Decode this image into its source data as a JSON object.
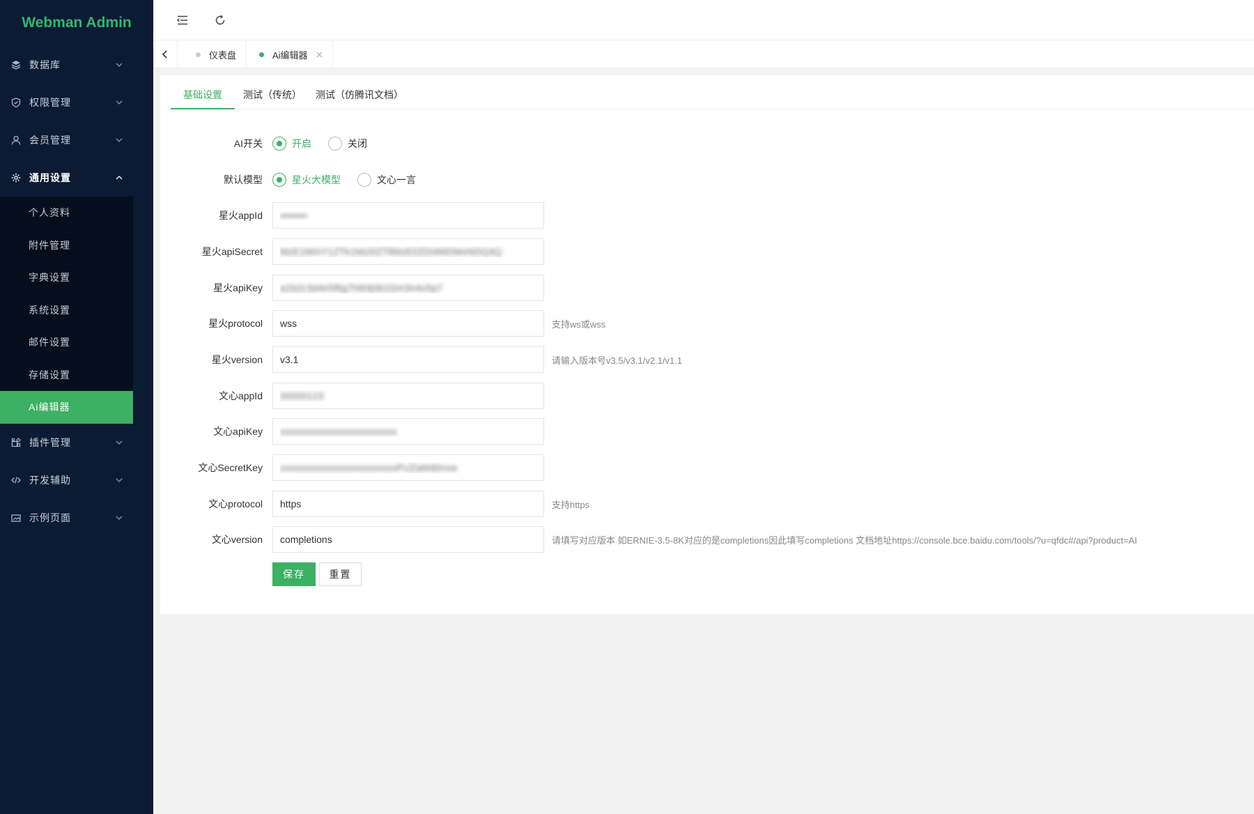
{
  "app": {
    "title": "Webman Admin"
  },
  "sidebar": {
    "items": [
      {
        "label": "数据库",
        "icon": "database-icon"
      },
      {
        "label": "权限管理",
        "icon": "shield-icon"
      },
      {
        "label": "会员管理",
        "icon": "user-icon"
      },
      {
        "label": "通用设置",
        "icon": "gear-icon",
        "open": true,
        "children": [
          "个人资料",
          "附件管理",
          "字典设置",
          "系统设置",
          "邮件设置",
          "存储设置",
          "Ai编辑器"
        ]
      },
      {
        "label": "插件管理",
        "icon": "plugin-icon"
      },
      {
        "label": "开发辅助",
        "icon": "code-icon"
      },
      {
        "label": "示例页面",
        "icon": "image-icon"
      }
    ],
    "active_child": "Ai编辑器"
  },
  "page_tabs": [
    {
      "label": "仪表盘",
      "active": false
    },
    {
      "label": "Ai编辑器",
      "active": true
    }
  ],
  "form_tabs": [
    "基础设置",
    "测试（传统）",
    "测试（仿腾讯文档）"
  ],
  "form": {
    "ai_switch": {
      "label": "AI开关",
      "options": [
        "开启",
        "关闭"
      ],
      "selected": "开启"
    },
    "default_model": {
      "label": "默认模型",
      "options": [
        "星火大模型",
        "文心一言"
      ],
      "selected": "星火大模型"
    },
    "fields": [
      {
        "label": "星火appId",
        "value": "••••••••",
        "blurred": true,
        "hint": ""
      },
      {
        "label": "星火apiSecret",
        "value": "MzE1MmY1ZTk1MzI0ZTllMzE0ZDI4MDMxNDQ4Q",
        "blurred": true,
        "hint": ""
      },
      {
        "label": "星火apiKey",
        "value": "a1b2c3d4e5f6g7h8i9j0k1l2m3n4o5p7",
        "blurred": true,
        "hint": ""
      },
      {
        "label": "星火protocol",
        "value": "wss",
        "blurred": false,
        "hint": "支持ws或wss"
      },
      {
        "label": "星火version",
        "value": "v3.1",
        "blurred": false,
        "hint": "请输入版本号v3.5/v3.1/v2.1/v1.1"
      },
      {
        "label": "文心appId",
        "value": "00000123",
        "blurred": true,
        "hint": ""
      },
      {
        "label": "文心apiKey",
        "value": "xxxxxxxxxxxxxxxxxxxxxxxx",
        "blurred": true,
        "hint": ""
      },
      {
        "label": "文心SecretKey",
        "value": "xxxxxxxxxxxxxxxxxxxxxxxxFUZaM4lmvw",
        "blurred": true,
        "hint": ""
      },
      {
        "label": "文心protocol",
        "value": "https",
        "blurred": false,
        "hint": "支持https"
      },
      {
        "label": "文心version",
        "value": "completions",
        "blurred": false,
        "hint": "请填写对应版本 如ERNIE-3.5-8K对应的是completions因此填写completions 文档地址https://console.bce.baidu.com/tools/?u=qfdc#/api?product=AI"
      }
    ],
    "buttons": {
      "save": "保存",
      "reset": "重置"
    }
  },
  "colors": {
    "accent": "#3cb063",
    "sidebar_bg": "#0a1b33",
    "submenu_bg": "#050e1c"
  }
}
